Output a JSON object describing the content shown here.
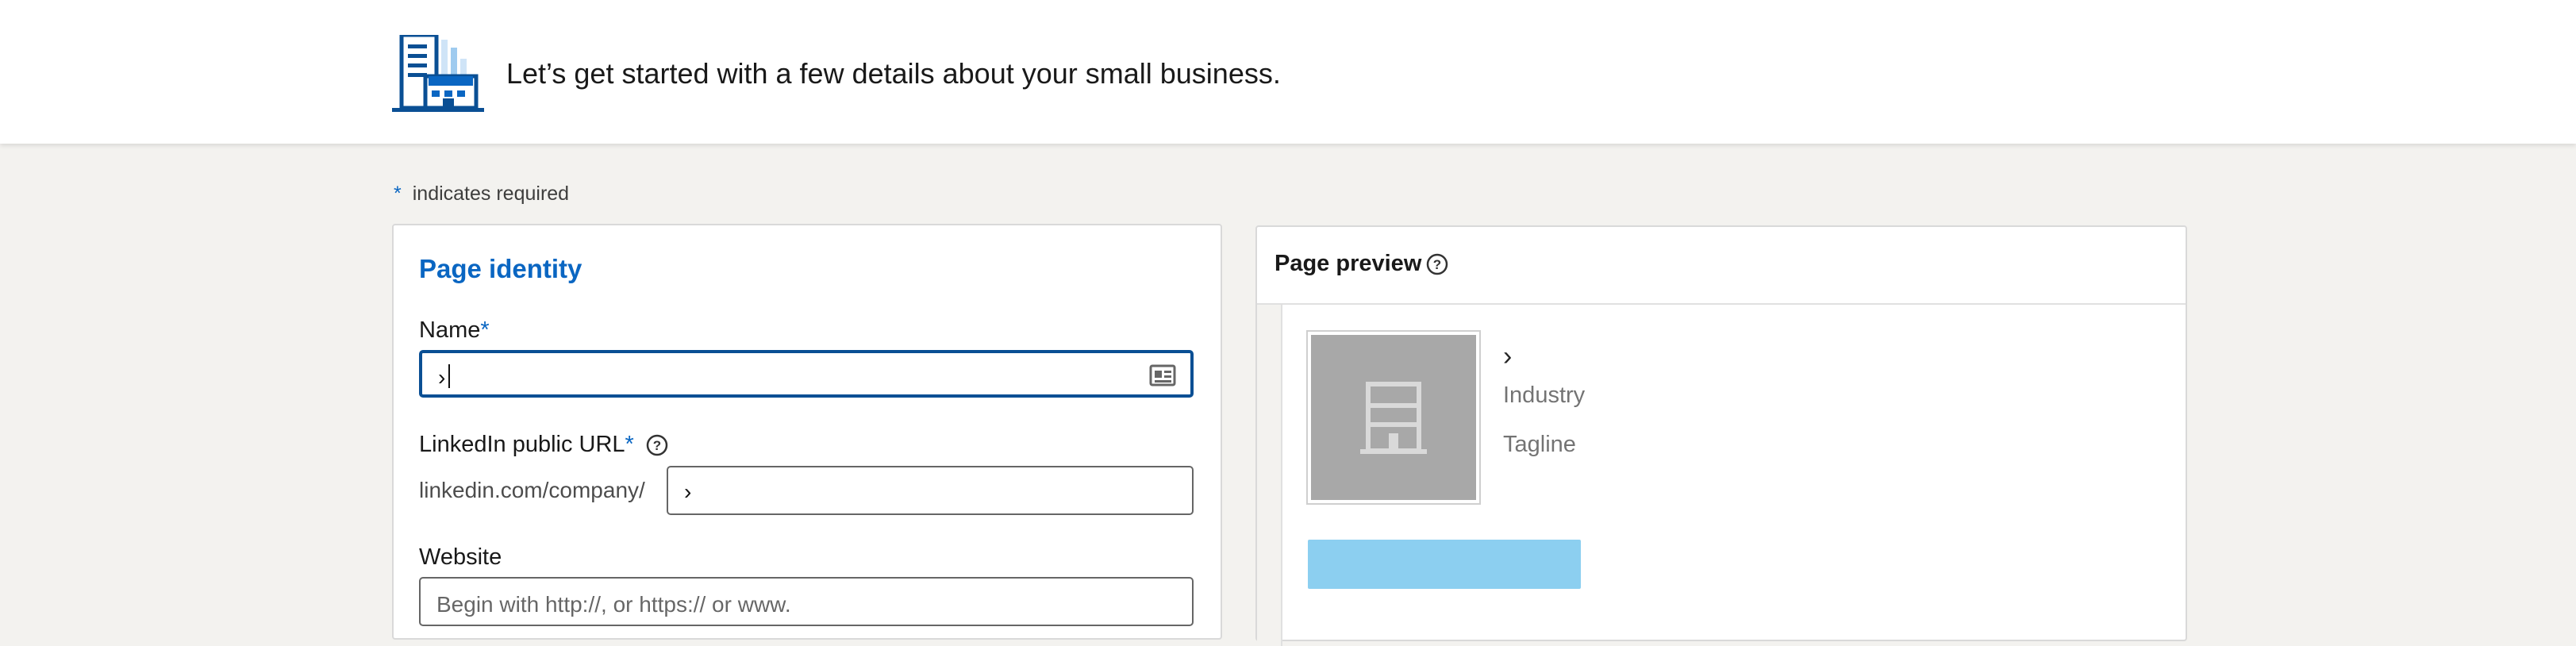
{
  "header": {
    "icon": "building-icon",
    "text": "Let’s get started with a few details about your small business."
  },
  "required_note": {
    "star": "*",
    "text": "indicates required"
  },
  "form": {
    "section_title": "Page identity",
    "name": {
      "label": "Name",
      "required_mark": "*",
      "value": "›",
      "icon": "contact-card-icon"
    },
    "url": {
      "label": "LinkedIn public URL",
      "required_mark": "*",
      "help_icon": "question-circle-icon",
      "prefix": "linkedin.com/company/",
      "value": "›"
    },
    "website": {
      "label": "Website",
      "placeholder": "Begin with http://, or https:// or www."
    }
  },
  "preview": {
    "title": "Page preview",
    "help_icon": "question-circle-icon",
    "logo_icon": "building-placeholder-icon",
    "name_chevron": "›",
    "industry": "Industry",
    "tagline": "Tagline"
  },
  "colors": {
    "brand_blue": "#0a66c2",
    "focus_border": "#0a4f94",
    "preview_button": "#8ccff0",
    "logo_placeholder": "#a8a8a8",
    "page_background": "#f3f2ef"
  }
}
